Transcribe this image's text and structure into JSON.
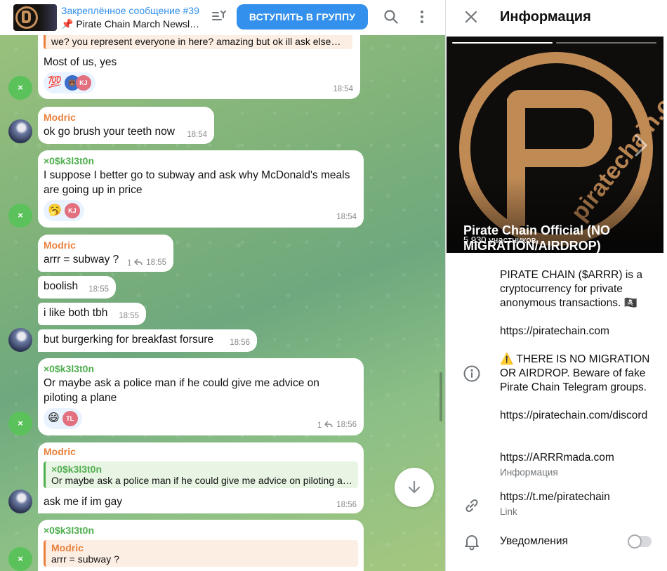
{
  "header": {
    "pinned_title": "Закреплённое сообщение #39",
    "pinned_text": "📌 Pirate Chain March Newsle…",
    "join_label": "ВСТУПИТЬ В ГРУППУ"
  },
  "messages": [
    {
      "id": "m1",
      "quote": "we? you represent everyone in here? amazing but ok ill ask elsewhere",
      "text": "Most of us, yes",
      "reactions": [
        "💯",
        "🐻",
        "KJ"
      ],
      "time": "18:54"
    },
    {
      "id": "m2",
      "author": "Modric",
      "text": "ok go brush your teeth now",
      "time": "18:54"
    },
    {
      "id": "m3",
      "author": "×0$k3l3t0n",
      "lines": [
        "I suppose I better go to subway and ask why McDonald's meals",
        "are going up in price"
      ],
      "reactions": [
        "🥱",
        "KJ"
      ],
      "time": "18:54"
    },
    {
      "id": "m4",
      "author": "Modric",
      "text": "arrr = subway ?",
      "replies": "1",
      "time": "18:55"
    },
    {
      "id": "m5",
      "text": "boolish",
      "time": "18:55"
    },
    {
      "id": "m6",
      "text": "i like both tbh",
      "time": "18:55"
    },
    {
      "id": "m7",
      "text": "but burgerking for breakfast forsure",
      "time": "18:56"
    },
    {
      "id": "m8",
      "author": "×0$k3l3t0n",
      "lines": [
        "Or maybe ask a police man if he could give me advice on",
        "piloting a plane"
      ],
      "reactions": [
        "😄",
        "TL"
      ],
      "replies": "1",
      "time": "18:56"
    },
    {
      "id": "m9",
      "author": "Modric",
      "quote_author": "×0$k3l3t0n",
      "quote": "Or maybe ask a police man if he could give me advice on piloting a p…",
      "text": "ask me if im gay",
      "time": "18:56"
    },
    {
      "id": "m10",
      "author": "×0$k3l3t0n",
      "quote_author": "Modric",
      "quote": "arrr = subway ?"
    }
  ],
  "avatar_initial": "×",
  "info": {
    "title": "Информация",
    "hero_url": "piratechain.com",
    "group_name": "Pirate Chain Official (NO MIGRATION/AIRDROP) $ARRR 🏴‍☠️⛓️",
    "members": "5 930 участников",
    "desc1": "PIRATE CHAIN ($ARRR) is a cryptocurrency for private anonymous transactions. 🏴‍☠️",
    "site": "https://piratechain.com",
    "warning": "⚠️ THERE IS NO MIGRATION OR AIRDROP. Beware of fake Pirate Chain Telegram groups.",
    "discord": "https://piratechain.com/discord",
    "arrrmada": "https://ARRRmada.com",
    "info_label": "Информация",
    "tme": "https://t.me/piratechain",
    "link_label": "Link",
    "notifications": "Уведомления",
    "notifications_on": false
  }
}
